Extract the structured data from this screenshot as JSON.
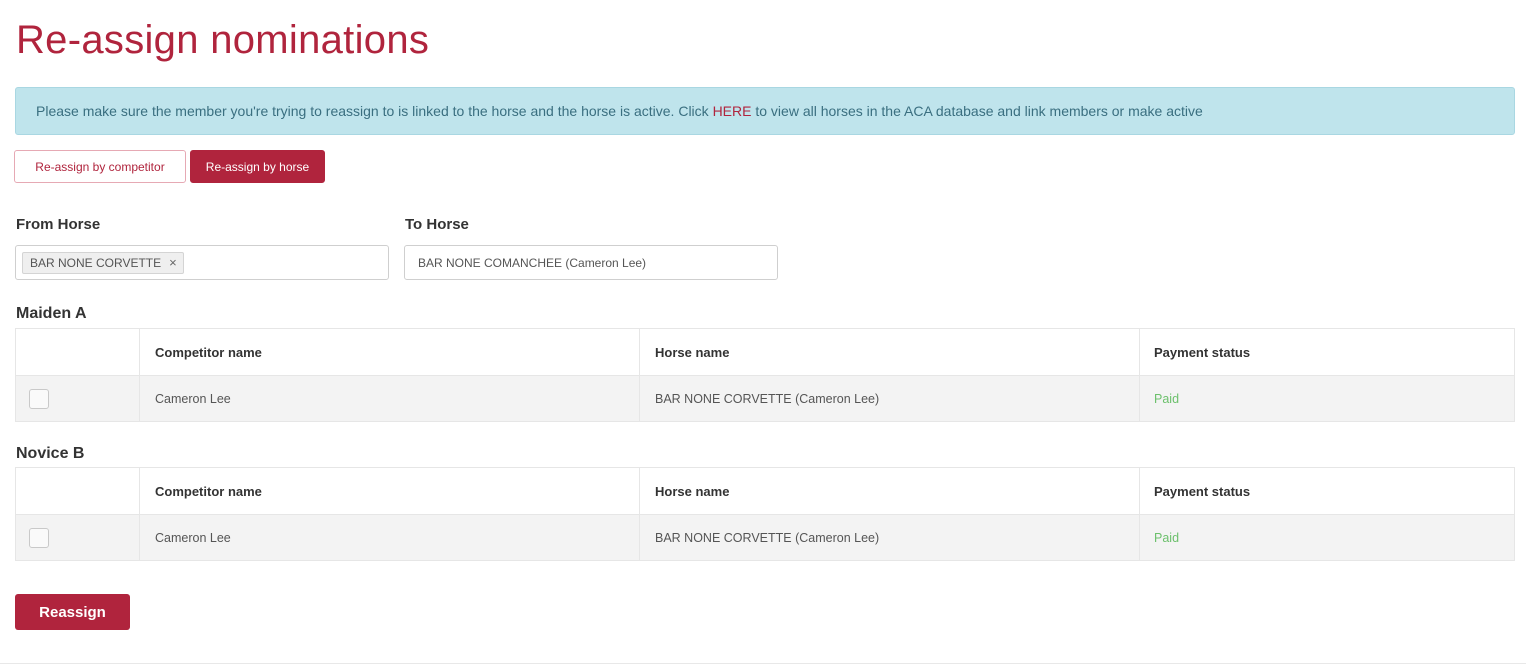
{
  "page": {
    "title": "Re-assign nominations"
  },
  "alert": {
    "text_before": "Please make sure the member you're trying to reassign to is linked to the horse and the horse is active. Click ",
    "link_text": "HERE",
    "text_after": " to view all horses in the ACA database and link members or make active"
  },
  "tabs": [
    {
      "label": "Re-assign by competitor",
      "active": false
    },
    {
      "label": "Re-assign by horse",
      "active": true
    }
  ],
  "from_horse": {
    "label": "From Horse",
    "selected_tag": "BAR NONE CORVETTE",
    "remove_glyph": "×"
  },
  "to_horse": {
    "label": "To Horse",
    "value": "BAR NONE COMANCHEE (Cameron Lee)"
  },
  "columns": {
    "competitor": "Competitor name",
    "horse": "Horse name",
    "payment": "Payment status"
  },
  "sections": [
    {
      "title": "Maiden A",
      "rows": [
        {
          "competitor": "Cameron Lee",
          "horse": "BAR NONE CORVETTE (Cameron Lee)",
          "payment": "Paid"
        }
      ]
    },
    {
      "title": "Novice B",
      "rows": [
        {
          "competitor": "Cameron Lee",
          "horse": "BAR NONE CORVETTE (Cameron Lee)",
          "payment": "Paid"
        }
      ]
    }
  ],
  "actions": {
    "reassign_label": "Reassign"
  },
  "colors": {
    "brand": "#b0243d",
    "alert_bg": "#bfe4ec",
    "paid": "#6cc06c"
  }
}
